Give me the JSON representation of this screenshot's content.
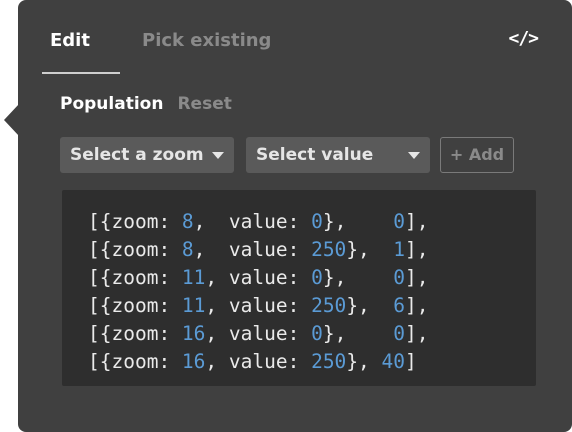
{
  "tabs": [
    {
      "label": "Edit",
      "active": true
    },
    {
      "label": "Pick existing",
      "active": false
    }
  ],
  "code_toggle_label": "</>",
  "section": {
    "title": "Population",
    "reset_label": "Reset"
  },
  "controls": {
    "zoom_select": "Select a zoom",
    "value_select": "Select value",
    "add_label": "+ Add"
  },
  "stops": [
    {
      "zoom": "8",
      "value": "0",
      "output": "0"
    },
    {
      "zoom": "8",
      "value": "250",
      "output": "1"
    },
    {
      "zoom": "11",
      "value": "0",
      "output": "0"
    },
    {
      "zoom": "11",
      "value": "250",
      "output": "6"
    },
    {
      "zoom": "16",
      "value": "0",
      "output": "0"
    },
    {
      "zoom": "16",
      "value": "250",
      "output": "40"
    }
  ],
  "colors": {
    "panel": "#404040",
    "code_bg": "#2e2e2e",
    "number": "#5b9bd5"
  }
}
